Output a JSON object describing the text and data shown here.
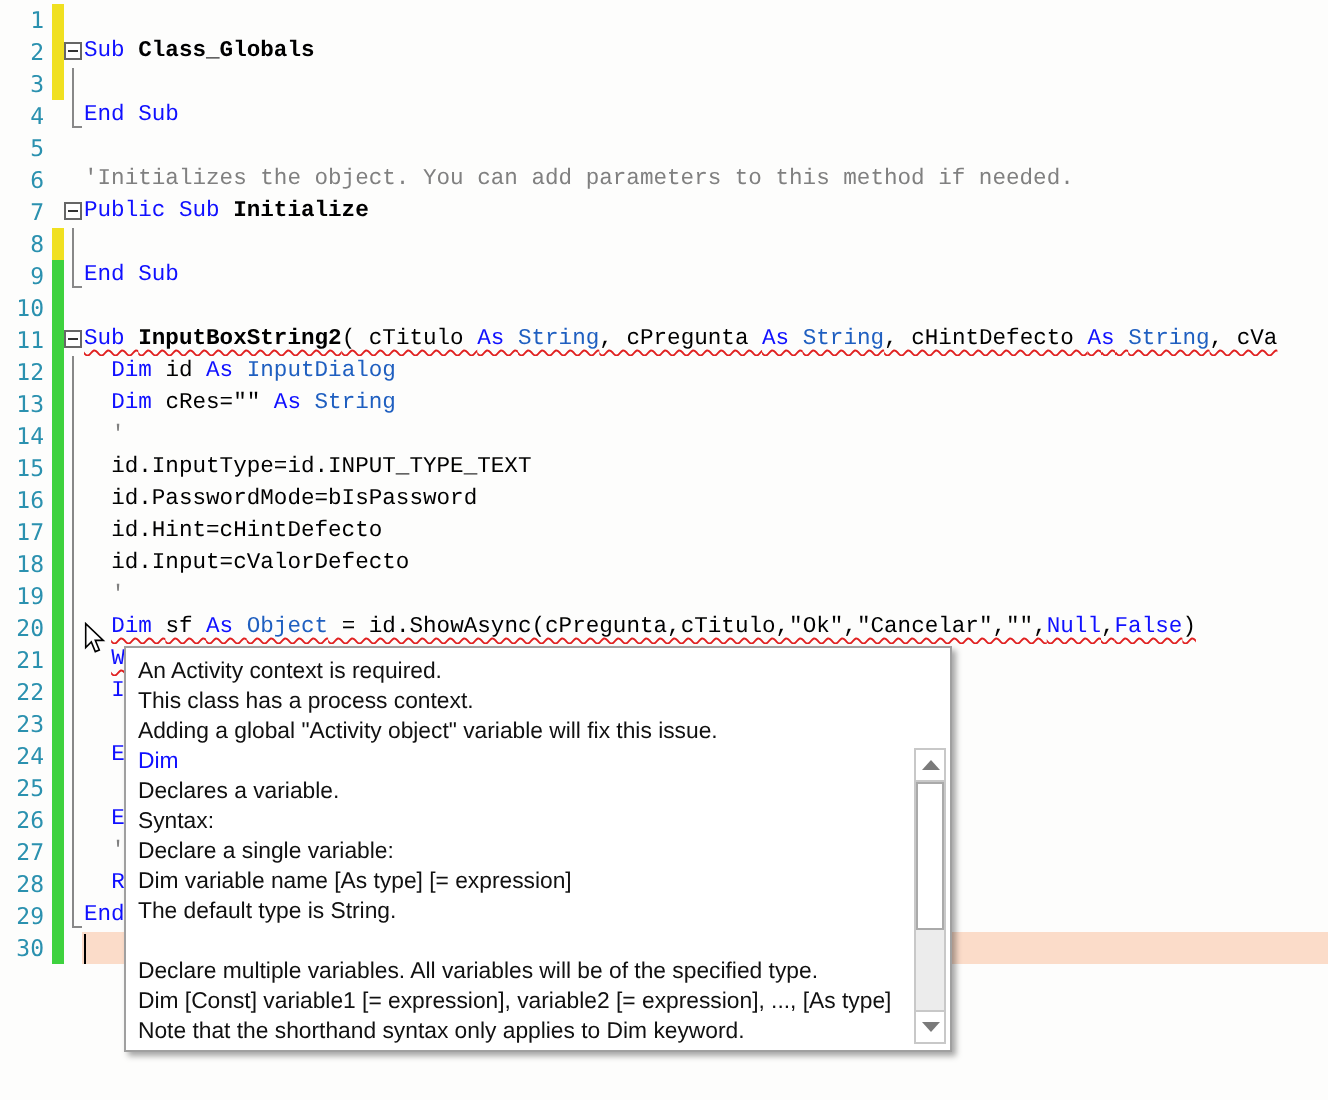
{
  "editor": {
    "lines": [
      {
        "number": "1",
        "color": "#f0e020",
        "squiggle": false,
        "current": false
      },
      {
        "number": "2",
        "color": "#f0e020",
        "squiggle": false,
        "current": false,
        "expanded": true,
        "tokens": [
          {
            "kind": "keyword",
            "text": "Sub "
          },
          {
            "kind": "name",
            "text": "Class_Globals"
          }
        ],
        "children": [
          {
            "number": "3",
            "color": "#f0e020",
            "squiggle": false,
            "current": false
          },
          {
            "number": "4",
            "squiggle": false,
            "current": false,
            "tokens": [
              {
                "kind": "keyword",
                "text": "End Sub"
              }
            ]
          }
        ]
      },
      {
        "number": "5",
        "squiggle": false,
        "current": false
      },
      {
        "number": "6",
        "squiggle": false,
        "current": false,
        "tokens": [
          {
            "kind": "comment",
            "text": "'Initializes the object. You can add parameters to this method if needed."
          }
        ]
      },
      {
        "number": "7",
        "squiggle": false,
        "current": false,
        "expanded": true,
        "tokens": [
          {
            "kind": "keyword",
            "text": "Public Sub "
          },
          {
            "kind": "name",
            "text": "Initialize"
          }
        ],
        "children": [
          {
            "number": "8",
            "color": "#f0e020",
            "squiggle": false,
            "current": false
          },
          {
            "number": "9",
            "color": "#3ed23e",
            "squiggle": false,
            "current": false,
            "tokens": [
              {
                "kind": "keyword",
                "text": "End Sub"
              }
            ]
          }
        ]
      },
      {
        "number": "10",
        "color": "#3ed23e",
        "squiggle": false,
        "current": false
      },
      {
        "number": "11",
        "color": "#3ed23e",
        "squiggle": true,
        "current": false,
        "expanded": true,
        "tokens": [
          {
            "kind": "keyword",
            "text": "Sub "
          },
          {
            "kind": "name",
            "text": "InputBoxString2"
          },
          {
            "kind": "plain",
            "text": "( cTitulo "
          },
          {
            "kind": "keyword",
            "text": "As "
          },
          {
            "kind": "type",
            "text": "String"
          },
          {
            "kind": "plain",
            "text": ", cPregunta "
          },
          {
            "kind": "keyword",
            "text": "As "
          },
          {
            "kind": "type",
            "text": "String"
          },
          {
            "kind": "plain",
            "text": ", cHintDefecto "
          },
          {
            "kind": "keyword",
            "text": "As "
          },
          {
            "kind": "type",
            "text": "String"
          },
          {
            "kind": "plain",
            "text": ", cVa"
          }
        ],
        "children": [
          {
            "number": "12",
            "color": "#3ed23e",
            "squiggle": false,
            "current": false,
            "tokens": [
              {
                "kind": "keyword",
                "text": "  Dim "
              },
              {
                "kind": "plain",
                "text": "id "
              },
              {
                "kind": "keyword",
                "text": "As "
              },
              {
                "kind": "type",
                "text": "InputDialog"
              }
            ]
          },
          {
            "number": "13",
            "color": "#3ed23e",
            "squiggle": false,
            "current": false,
            "tokens": [
              {
                "kind": "keyword",
                "text": "  Dim "
              },
              {
                "kind": "plain",
                "text": "cRes=\"\" "
              },
              {
                "kind": "keyword",
                "text": "As "
              },
              {
                "kind": "type",
                "text": "String"
              }
            ]
          },
          {
            "number": "14",
            "color": "#3ed23e",
            "squiggle": false,
            "current": false,
            "tokens": [
              {
                "kind": "comment",
                "text": "  '"
              }
            ]
          },
          {
            "number": "15",
            "color": "#3ed23e",
            "squiggle": false,
            "current": false,
            "tokens": [
              {
                "kind": "plain",
                "text": "  id.InputType=id.INPUT_TYPE_TEXT"
              }
            ]
          },
          {
            "number": "16",
            "color": "#3ed23e",
            "squiggle": false,
            "current": false,
            "tokens": [
              {
                "kind": "plain",
                "text": "  id.PasswordMode=bIsPassword"
              }
            ]
          },
          {
            "number": "17",
            "color": "#3ed23e",
            "squiggle": false,
            "current": false,
            "tokens": [
              {
                "kind": "plain",
                "text": "  id.Hint=cHintDefecto"
              }
            ]
          },
          {
            "number": "18",
            "color": "#3ed23e",
            "squiggle": false,
            "current": false,
            "tokens": [
              {
                "kind": "plain",
                "text": "  id.Input=cValorDefecto"
              }
            ]
          },
          {
            "number": "19",
            "color": "#3ed23e",
            "squiggle": false,
            "current": false,
            "tokens": [
              {
                "kind": "comment",
                "text": "  '"
              }
            ]
          },
          {
            "number": "20",
            "color": "#3ed23e",
            "squiggle": true,
            "current": false,
            "tokens": [
              {
                "kind": "keyword",
                "text": "  Dim "
              },
              {
                "kind": "plain",
                "text": "sf "
              },
              {
                "kind": "keyword",
                "text": "As "
              },
              {
                "kind": "type",
                "text": "Object"
              },
              {
                "kind": "plain",
                "text": " = id.ShowAsync(cPregunta,cTitulo,\"Ok\",\"Cancelar\",\"\","
              },
              {
                "kind": "keyword",
                "text": "Null"
              },
              {
                "kind": "plain",
                "text": ","
              },
              {
                "kind": "keyword",
                "text": "False"
              },
              {
                "kind": "plain",
                "text": ")"
              }
            ]
          },
          {
            "number": "21",
            "color": "#3ed23e",
            "squiggle": true,
            "current": false,
            "tokens": [
              {
                "kind": "keyword",
                "text": "  W"
              }
            ]
          },
          {
            "number": "22",
            "color": "#3ed23e",
            "squiggle": false,
            "current": false,
            "tokens": [
              {
                "kind": "keyword",
                "text": "  I"
              }
            ]
          },
          {
            "number": "23",
            "color": "#3ed23e",
            "squiggle": false,
            "current": false
          },
          {
            "number": "24",
            "color": "#3ed23e",
            "squiggle": false,
            "current": false,
            "tokens": [
              {
                "kind": "keyword",
                "text": "  E"
              }
            ]
          },
          {
            "number": "25",
            "color": "#3ed23e",
            "squiggle": false,
            "current": false
          },
          {
            "number": "26",
            "color": "#3ed23e",
            "squiggle": false,
            "current": false,
            "tokens": [
              {
                "kind": "keyword",
                "text": "  E"
              }
            ]
          },
          {
            "number": "27",
            "color": "#3ed23e",
            "squiggle": false,
            "current": false,
            "tokens": [
              {
                "kind": "comment",
                "text": "  '"
              }
            ]
          },
          {
            "number": "28",
            "color": "#3ed23e",
            "squiggle": false,
            "current": false,
            "tokens": [
              {
                "kind": "keyword",
                "text": "  R"
              }
            ]
          },
          {
            "number": "29",
            "color": "#3ed23e",
            "squiggle": false,
            "current": false,
            "tokens": [
              {
                "kind": "keyword",
                "text": "End"
              }
            ]
          }
        ]
      },
      {
        "number": "30",
        "color": "#3ed23e",
        "squiggle": false,
        "current": true
      }
    ]
  },
  "tooltip": {
    "lines": [
      {
        "kind": "text",
        "text": "An Activity context is required."
      },
      {
        "kind": "text",
        "text": "This class has a process context."
      },
      {
        "kind": "text",
        "text": "Adding a global \"Activity object\" variable will fix this issue."
      },
      {
        "kind": "keyword",
        "text": "Dim"
      },
      {
        "kind": "text",
        "text": "Declares a variable."
      },
      {
        "kind": "text",
        "text": "Syntax:"
      },
      {
        "kind": "text",
        "text": "Declare a single variable:"
      },
      {
        "kind": "text",
        "text": "Dim variable name [As type] [= expression]"
      },
      {
        "kind": "text",
        "text": "The default type is String."
      },
      {
        "kind": "gap"
      },
      {
        "kind": "text",
        "text": "Declare multiple variables. All variables will be of the specified type."
      },
      {
        "kind": "text",
        "text": "Dim [Const] variable1 [= expression], variable2 [= expression], ..., [As type]"
      },
      {
        "kind": "text",
        "text": "Note that the shorthand syntax only applies to Dim keyword."
      }
    ]
  }
}
